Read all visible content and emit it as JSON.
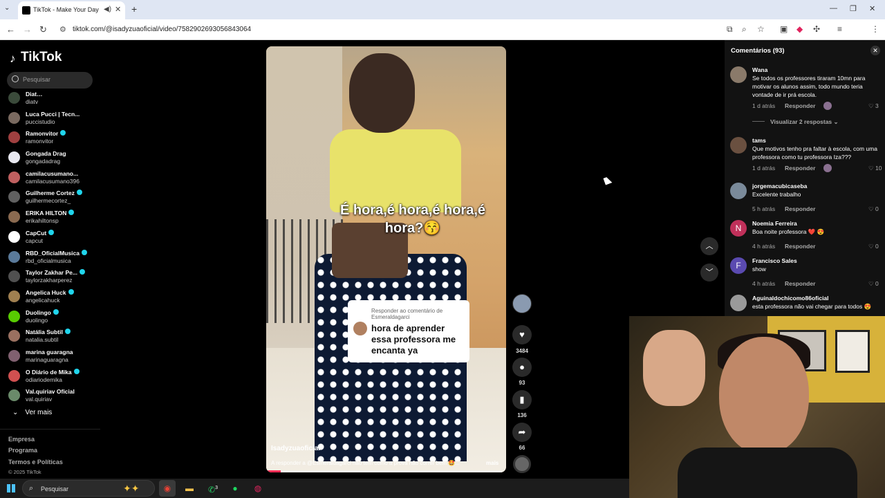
{
  "browser": {
    "tab_title": "TikTok - Make Your Day",
    "url": "tiktok.com/@isadyzuaoficial/video/7582902693056843064"
  },
  "sidebar": {
    "logo": "TikTok",
    "search_placeholder": "Pesquisar",
    "following": [
      {
        "name": "Diat…",
        "handle": "diatv",
        "verified": false,
        "color": "#3a4a3a"
      },
      {
        "name": "Luca Pucci | Tecn...",
        "handle": "puccistudio",
        "verified": false,
        "color": "#7a6a60"
      },
      {
        "name": "Ramonvitor",
        "handle": "ramonvitor",
        "verified": true,
        "color": "#a04040"
      },
      {
        "name": "Gongada Drag",
        "handle": "gongadadrag",
        "verified": false,
        "color": "#e8e8f0"
      },
      {
        "name": "camilacusumano...",
        "handle": "camilacusumano396",
        "verified": false,
        "color": "#c06060"
      },
      {
        "name": "Guilherme Cortez",
        "handle": "guilhermecortez_",
        "verified": true,
        "color": "#606060"
      },
      {
        "name": "ERIKA HILTON",
        "handle": "erikahiltonsp",
        "verified": true,
        "color": "#8a6a50"
      },
      {
        "name": "CapCut",
        "handle": "capcut",
        "verified": true,
        "color": "#ffffff"
      },
      {
        "name": "RBD_OficialMusica",
        "handle": "rbd_oficialmusica",
        "verified": true,
        "color": "#5a7a9a"
      },
      {
        "name": "Taylor Zakhar Pe...",
        "handle": "taylorzakharperez",
        "verified": true,
        "color": "#505050"
      },
      {
        "name": "Angelica Huck",
        "handle": "angelicahuck",
        "verified": true,
        "color": "#a08050"
      },
      {
        "name": "Duolingo",
        "handle": "duolingo",
        "verified": true,
        "color": "#58cc02"
      },
      {
        "name": "Natália Subtil",
        "handle": "natalia.subtil",
        "verified": true,
        "color": "#9a7060"
      },
      {
        "name": "marina guaragna",
        "handle": "marinaguaragna",
        "verified": false,
        "color": "#806070"
      },
      {
        "name": "O Diário de Mika",
        "handle": "odiariodemika",
        "verified": true,
        "color": "#d05050"
      },
      {
        "name": "Val.quiriav Oficial",
        "handle": "val.quiriav",
        "verified": false,
        "color": "#6a8a6a"
      }
    ],
    "see_more": "Ver mais",
    "footer_links": [
      "Empresa",
      "Programa",
      "Termos e Políticas"
    ],
    "copyright": "© 2025 TikTok"
  },
  "video": {
    "overlay_text": "É hora,é hora,é hora,é hora?😚",
    "reply_label": "Responder ao comentário de Esmeraldagarci",
    "reply_text": "hora de aprender essa professora me encanta ya",
    "author": "Isadyzuaoficial",
    "description": "A responder a @Esmeraldagarci não tem como a prova não correr bem 🤩...",
    "more": "mais",
    "progress": 0.06
  },
  "actions": {
    "likes": "3484",
    "comments": "93",
    "saves": "136",
    "shares": "66"
  },
  "comments": {
    "header": "Comentários (93)",
    "view_replies": "Visualizar 2 respostas",
    "items": [
      {
        "name": "Wana",
        "text": "Se todos os professores tiraram 10mn para motivar os alunos assim, todo mundo teria vontade de ir prá escola.",
        "time": "1 d atrás",
        "reply": "Responder",
        "likes": "3",
        "avatar_letter": "",
        "color": "#8a7a6a"
      },
      {
        "name": "tams",
        "text": "Que motivos tenho pra faltar à escola, com uma professora como tu professora Iza???",
        "time": "1 d atrás",
        "reply": "Responder",
        "likes": "10",
        "avatar_letter": "",
        "color": "#6a5040"
      },
      {
        "name": "jorgemacubicaseba",
        "text": "Excelente trabalho",
        "time": "5 h atrás",
        "reply": "Responder",
        "likes": "0",
        "avatar_letter": "",
        "color": "#7a8a9a"
      },
      {
        "name": "Noemia Ferreira",
        "text": "Boa noite professora ❤️ 😍",
        "time": "4 h atrás",
        "reply": "Responder",
        "likes": "0",
        "avatar_letter": "N",
        "color": "#c0305a"
      },
      {
        "name": "Francisco Sales",
        "text": "show",
        "time": "4 h atrás",
        "reply": "Responder",
        "likes": "0",
        "avatar_letter": "F",
        "color": "#5a4ab0"
      },
      {
        "name": "Aguinaldochicomo86oficial",
        "text": "esta professora não vai chegar para todos 😍",
        "time": "",
        "reply": "",
        "likes": "",
        "avatar_letter": "",
        "color": "#9a9a9a"
      }
    ]
  },
  "taskbar": {
    "search": "Pesquisar",
    "whatsapp_badge": "3"
  }
}
